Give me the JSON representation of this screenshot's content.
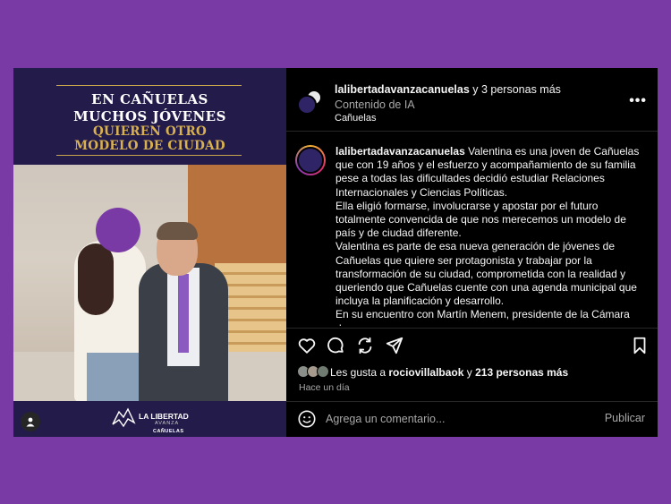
{
  "image": {
    "banner_line1": "EN CAÑUELAS",
    "banner_line2": "MUCHOS JÓVENES",
    "banner_line3": "QUIEREN OTRO",
    "banner_line4": "MODELO DE CIUDAD",
    "logo_title": "LA LIBERTAD",
    "logo_sub": "AVANZA",
    "logo_city": "CAÑUELAS"
  },
  "header": {
    "username": "lalibertadavanzacanuelas",
    "collaborators": " y 3 personas más",
    "ai_label": "Contenido de IA",
    "location": "Cañuelas",
    "more_icon": "more-horizontal-icon"
  },
  "caption": {
    "username": "lalibertadavanzacanuelas",
    "p1": " Valentina es una joven de Cañuelas que con 19 años y el esfuerzo y acompañamiento de su familia pese a todas las dificultades decidió estudiar Relaciones Internacionales y Ciencias Políticas.",
    "p2": "Ella eligió formarse, involucrarse y apostar por el futuro totalmente convencida de que nos merecemos un modelo de país y de ciudad diferente.",
    "p3": "Valentina es parte de esa nueva generación de jóvenes de Cañuelas que quiere ser protagonista y trabajar por la transformación de su ciudad, comprometida con la realidad y queriendo que Cañuelas cuente con una agenda municipal que incluya la planificación y desarrollo.",
    "p4": "En su encuentro con Martín Menem, presidente de la Cámara de"
  },
  "actions": {
    "icons": [
      "heart-icon",
      "comment-icon",
      "share-icon",
      "send-icon",
      "bookmark-icon"
    ]
  },
  "likes": {
    "prefix": "Les gusta a ",
    "user": "rociovillalbaok",
    "middle": " y ",
    "count": "213 personas más",
    "time": "Hace un día"
  },
  "comment": {
    "placeholder": "Agrega un comentario...",
    "publish": "Publicar"
  },
  "colors": {
    "background": "#7a3aa6",
    "panel": "#000000",
    "banner": "#231b4a",
    "gold": "#d9b24f"
  }
}
